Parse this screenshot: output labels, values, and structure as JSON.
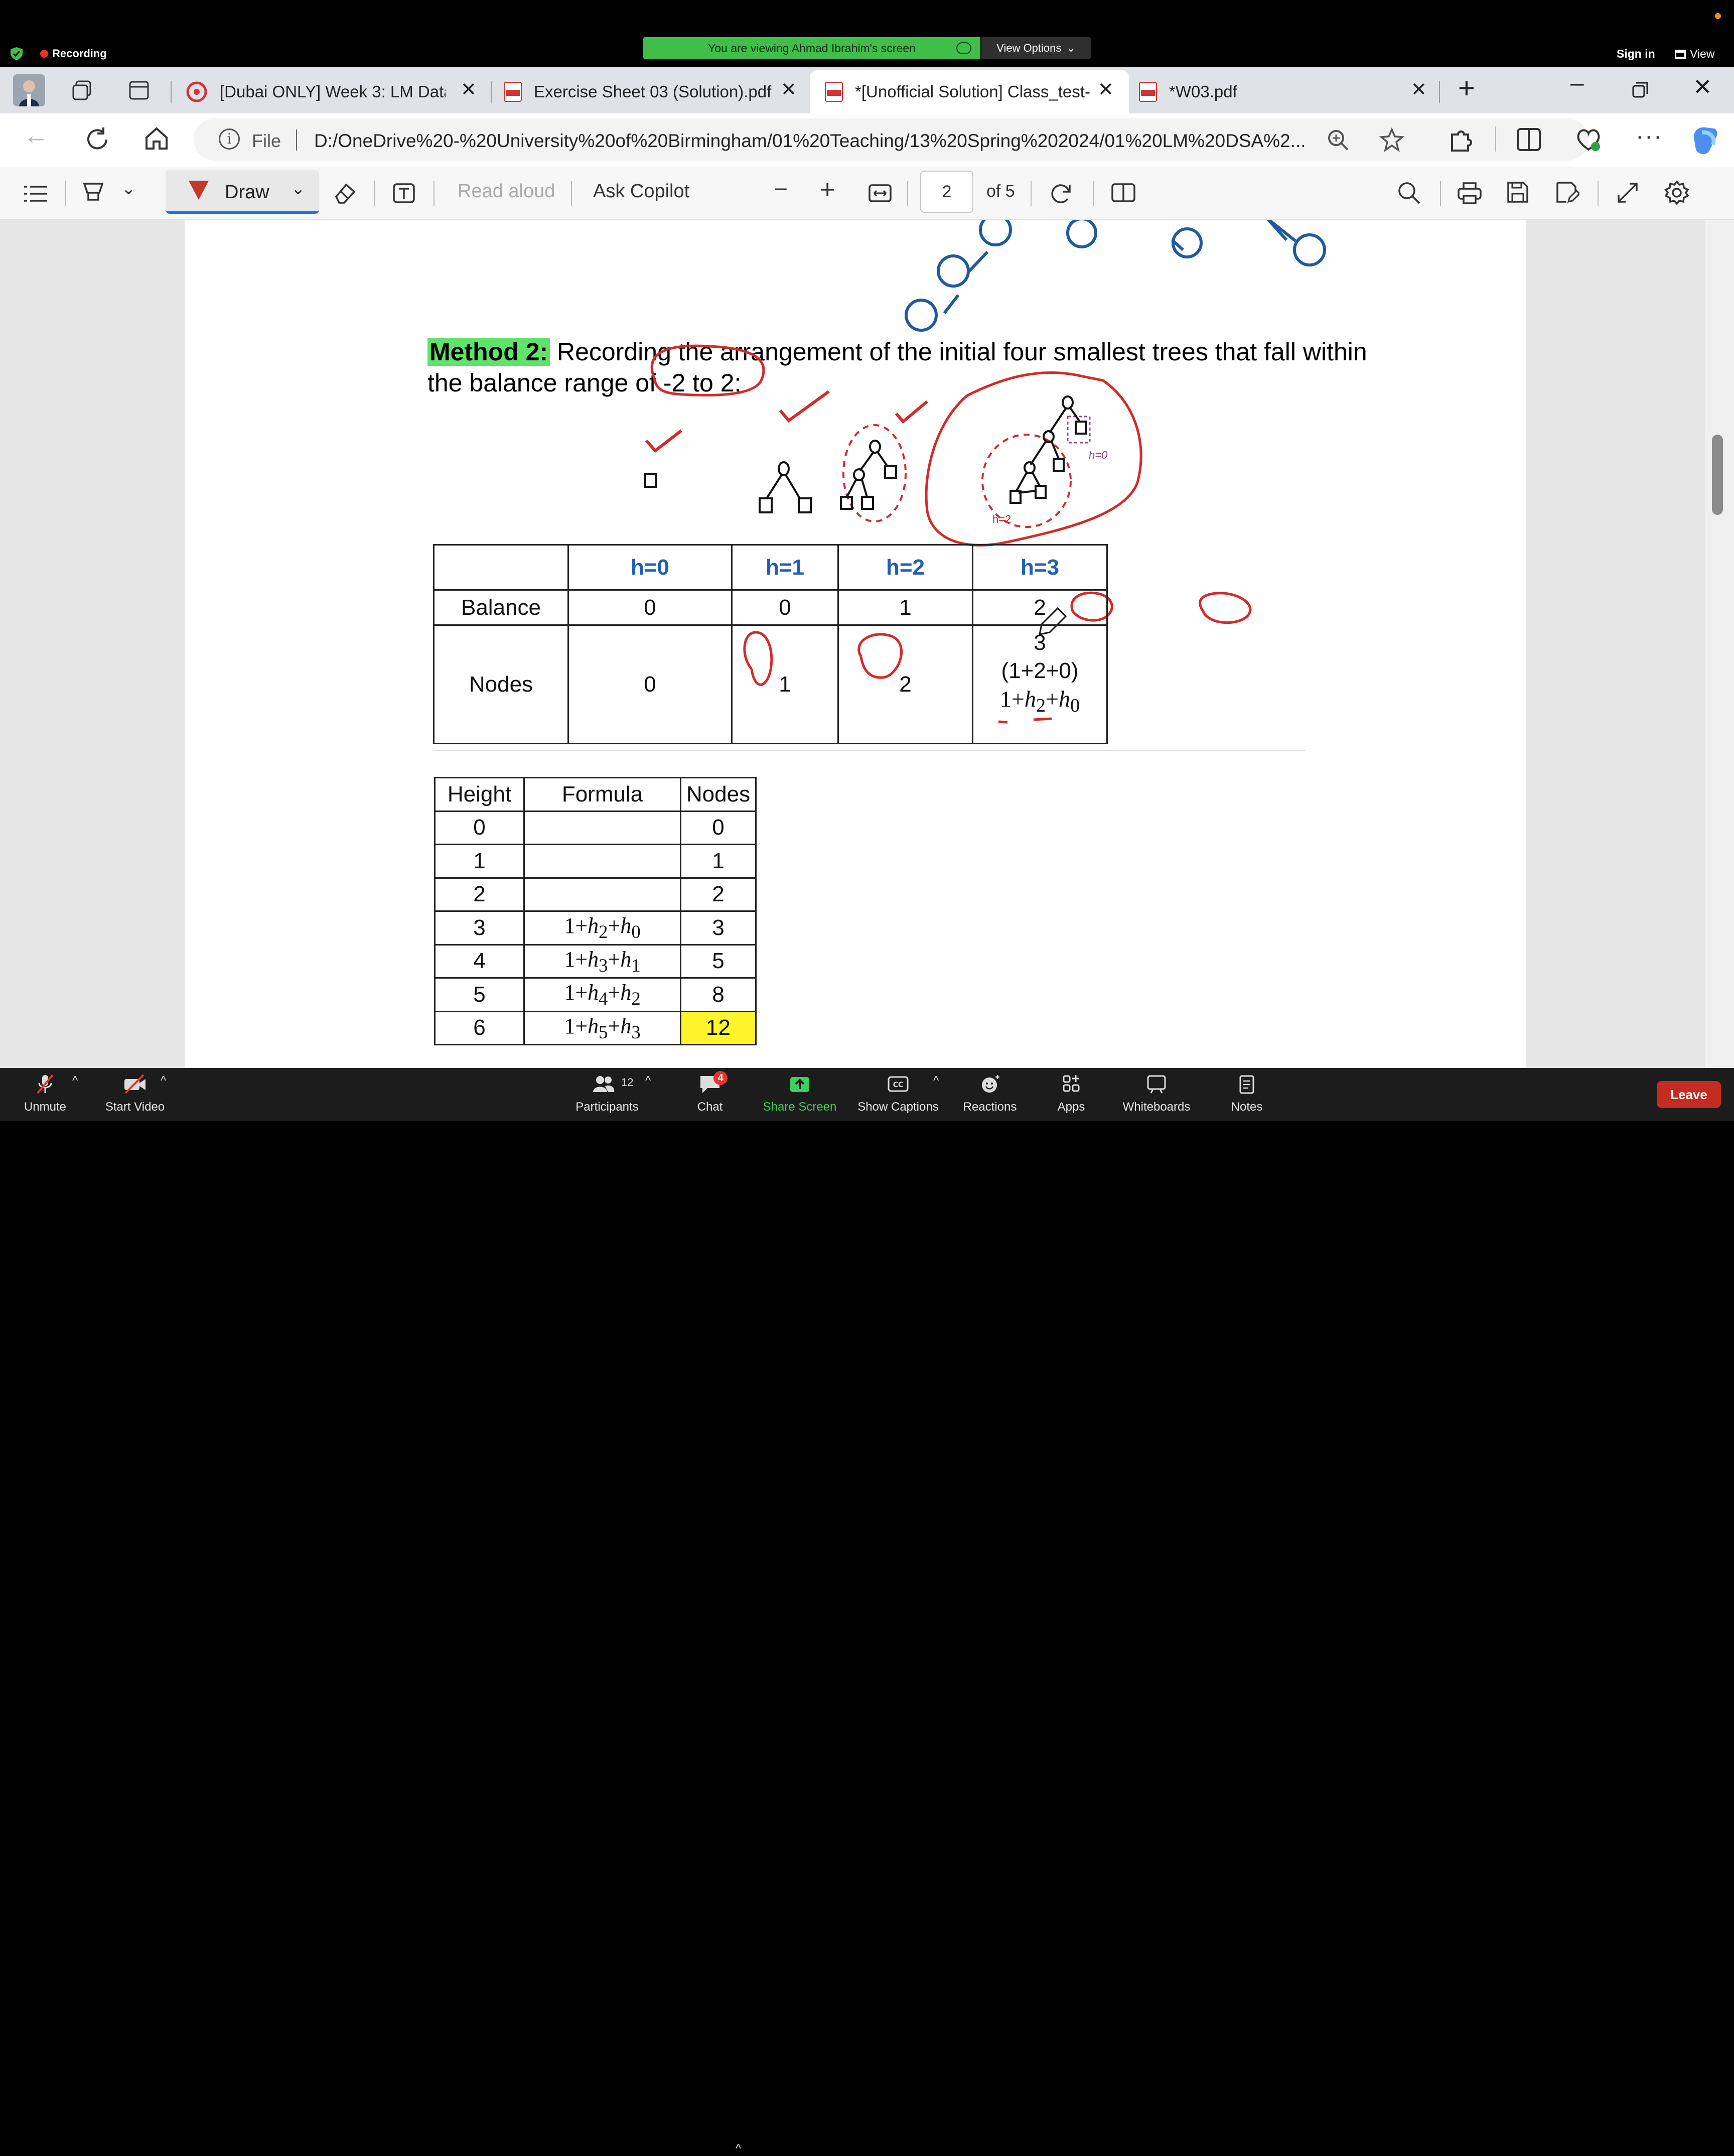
{
  "zoom": {
    "recording_label": "Recording",
    "viewing_banner": "You are viewing Ahmad Ibrahim's screen",
    "view_options_label": "View Options",
    "sign_in_label": "Sign in",
    "view_label": "View",
    "bottom": {
      "unmute": "Unmute",
      "start_video": "Start Video",
      "participants": "Participants",
      "participants_count": "12",
      "chat": "Chat",
      "chat_badge": "4",
      "share_screen": "Share Screen",
      "show_captions": "Show Captions",
      "reactions": "Reactions",
      "apps": "Apps",
      "whiteboards": "Whiteboards",
      "notes": "Notes",
      "leave": "Leave"
    },
    "colors": {
      "banner_green": "#3fbf4a",
      "leave_red": "#c42b21",
      "share_green": "#3ccf5b"
    }
  },
  "browser": {
    "tabs": [
      {
        "title": "[Dubai ONLY] Week 3: LM Data",
        "icon": "canvas-icon"
      },
      {
        "title": "Exercise Sheet 03 (Solution).pdf",
        "icon": "pdf-icon"
      },
      {
        "title": "*[Unofficial Solution] Class_test-",
        "icon": "pdf-icon",
        "active": true
      },
      {
        "title": "*W03.pdf",
        "icon": "pdf-icon"
      }
    ],
    "address": {
      "scheme_label": "File",
      "url": "D:/OneDrive%20-%20University%20of%20Birmingham/01%20Teaching/13%20Spring%202024/01%20LM%20DSA%2..."
    }
  },
  "pdf_toolbar": {
    "draw_label": "Draw",
    "read_aloud_label": "Read aloud",
    "ask_copilot_label": "Ask Copilot",
    "page_current": "2",
    "page_total": "of 5"
  },
  "document": {
    "method_label": "Method 2:",
    "method_text": " Recording the arrangement of the initial four smallest trees that fall within",
    "method_text_2a": "the balance range of ",
    "method_range": "-2 to 2:",
    "annotations": {
      "h2_label": "h=2",
      "h0_label": "h=0"
    },
    "balance_table": {
      "headers": [
        "",
        "h=0",
        "h=1",
        "h=2",
        "h=3"
      ],
      "balance_row": [
        "Balance",
        "0",
        "0",
        "1",
        "2"
      ],
      "nodes_row": [
        "Nodes",
        "0",
        "1",
        "2"
      ],
      "nodes_h3_lines": [
        "3",
        "(1+2+0)",
        "1+h2+h0"
      ]
    },
    "formula_table": {
      "headers": [
        "Height",
        "Formula",
        "Nodes"
      ],
      "rows": [
        {
          "height": "0",
          "formula": "",
          "nodes": "0"
        },
        {
          "height": "1",
          "formula": "",
          "nodes": "1"
        },
        {
          "height": "2",
          "formula": "",
          "nodes": "2"
        },
        {
          "height": "3",
          "formula": "1+h2+h0",
          "a": "2",
          "b": "0",
          "nodes": "3"
        },
        {
          "height": "4",
          "formula": "1+h3+h1",
          "a": "3",
          "b": "1",
          "nodes": "5"
        },
        {
          "height": "5",
          "formula": "1+h4+h2",
          "a": "4",
          "b": "2",
          "nodes": "8"
        },
        {
          "height": "6",
          "formula": "1+h5+h3",
          "a": "5",
          "b": "3",
          "nodes": "12",
          "highlight": true
        }
      ]
    },
    "colors": {
      "ink_red": "#d42a2a",
      "tree_blue": "#1f5a9c",
      "header_blue": "#1f5fb5",
      "method_green": "#5fe36b",
      "highlight_yellow": "#fff52a"
    }
  }
}
